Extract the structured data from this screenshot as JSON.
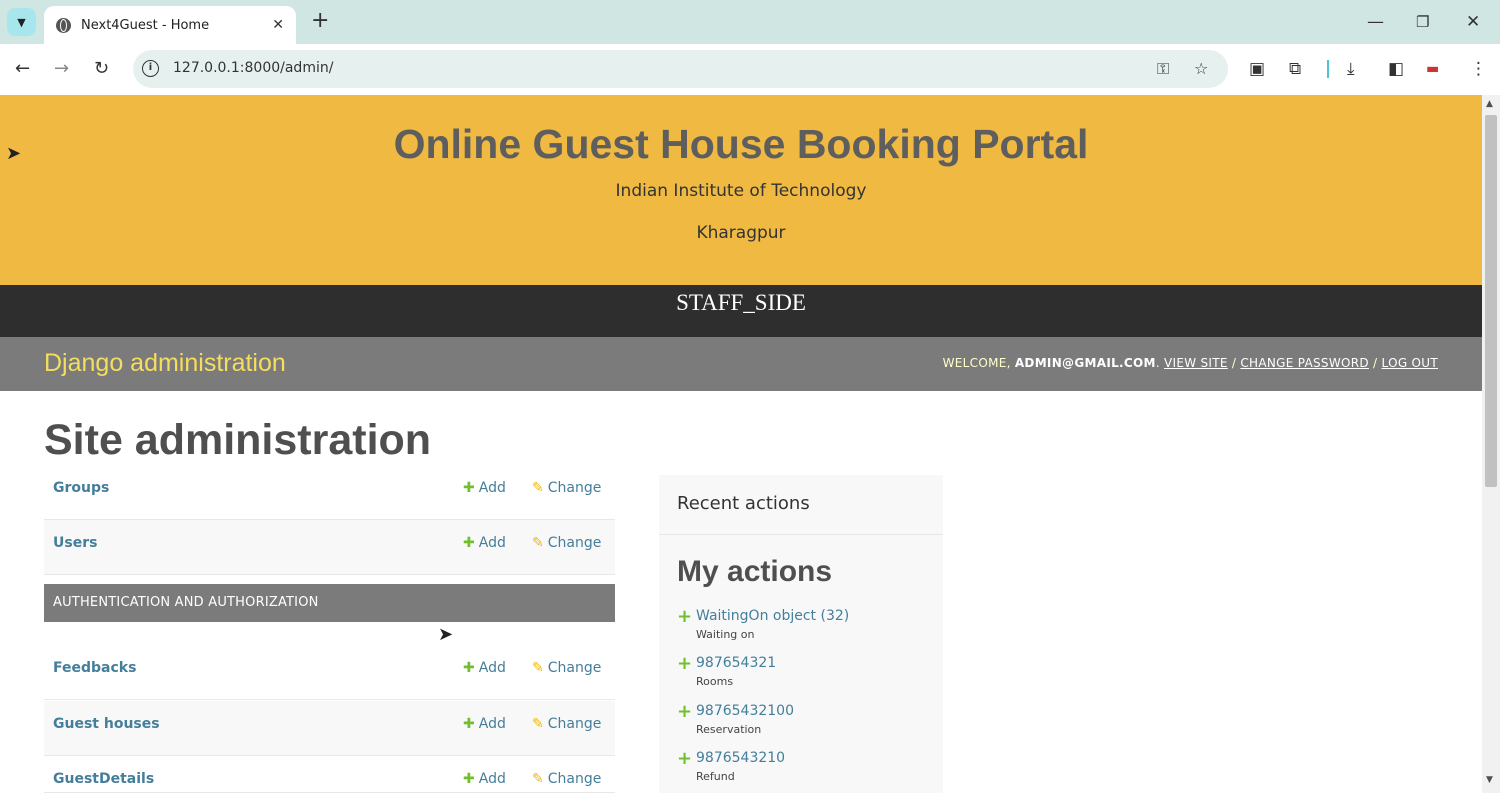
{
  "browser": {
    "tab_title": "Next4Guest - Home",
    "url": "127.0.0.1:8000/admin/"
  },
  "banner": {
    "title": "Online Guest House Booking Portal",
    "institute": "Indian Institute of Technology",
    "location": "Kharagpur"
  },
  "staff_bar": "STAFF_SIDE",
  "header": {
    "branding": "Django administration",
    "welcome": "WELCOME,",
    "user": "ADMIN@GMAIL.COM",
    "view_site": "VIEW SITE",
    "change_password": "CHANGE PASSWORD",
    "log_out": "LOG OUT"
  },
  "page_title": "Site administration",
  "models_top": [
    {
      "name": "Groups",
      "add": "Add",
      "change": "Change"
    },
    {
      "name": "Users",
      "add": "Add",
      "change": "Change"
    }
  ],
  "section_caption": "AUTHENTICATION AND AUTHORIZATION",
  "models_bottom": [
    {
      "name": "Feedbacks",
      "add": "Add",
      "change": "Change"
    },
    {
      "name": "Guest houses",
      "add": "Add",
      "change": "Change"
    },
    {
      "name": "GuestDetails",
      "add": "Add",
      "change": "Change"
    }
  ],
  "recent_actions": {
    "title": "Recent actions",
    "subtitle": "My actions",
    "items": [
      {
        "label": "WaitingOn object (32)",
        "type": "Waiting on"
      },
      {
        "label": "987654321",
        "type": "Rooms"
      },
      {
        "label": "98765432100",
        "type": "Reservation"
      },
      {
        "label": "9876543210",
        "type": "Refund"
      }
    ]
  },
  "colors": {
    "banner": "#f0b942",
    "staff_bar": "#2e2e2e",
    "django_header": "#7b7b7b",
    "branding": "#f5dd5d",
    "link": "#447e9b",
    "add_icon": "#70bf2b",
    "change_icon": "#efb80b"
  }
}
